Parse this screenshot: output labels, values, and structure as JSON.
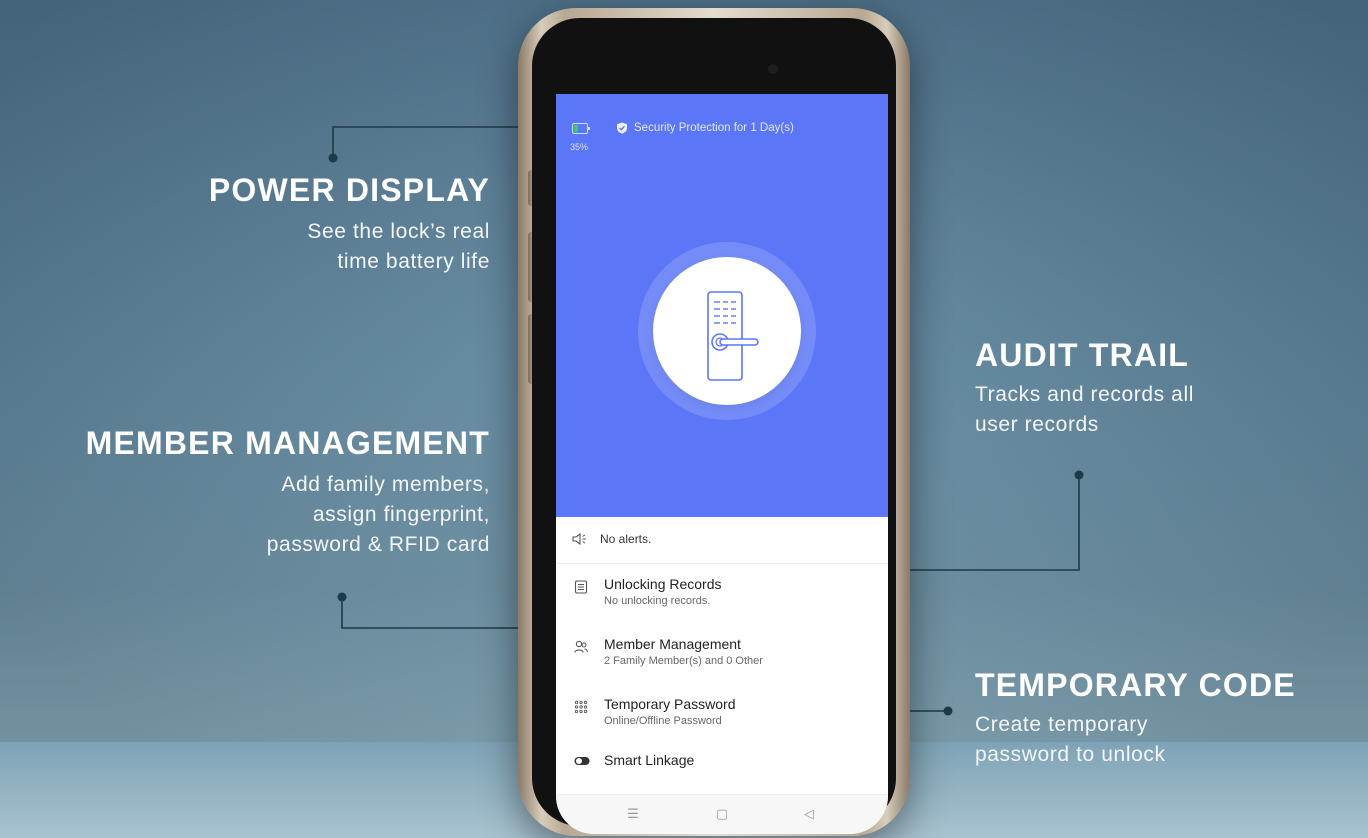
{
  "features": {
    "power": {
      "title": "POWER DISPLAY",
      "desc1": "See the lock’s real",
      "desc2": "time battery life"
    },
    "member": {
      "title": "MEMBER MANAGEMENT",
      "desc1": "Add family members,",
      "desc2": "assign fingerprint,",
      "desc3": "password & RFID card"
    },
    "audit": {
      "title": "AUDIT TRAIL",
      "desc1": "Tracks and records all",
      "desc2": "user records"
    },
    "temp": {
      "title": "TEMPORARY CODE",
      "desc1": "Create temporary",
      "desc2": "password to unlock"
    }
  },
  "app": {
    "battery_percent": "35%",
    "battery_level": 0.35,
    "security_text": "Security Protection for 1 Day(s)",
    "alerts_text": "No alerts.",
    "menu": [
      {
        "title": "Unlocking Records",
        "subtitle": "No unlocking records.",
        "icon": "document-icon"
      },
      {
        "title": "Member Management",
        "subtitle": "2 Family Member(s) and 0 Other",
        "icon": "members-icon"
      },
      {
        "title": "Temporary Password",
        "subtitle": "Online/Offline Password",
        "icon": "keypad-icon"
      },
      {
        "title": "Smart Linkage",
        "subtitle": "",
        "icon": "toggle-icon"
      }
    ],
    "nav": [
      "menu-icon",
      "home-square-icon",
      "back-triangle-icon"
    ]
  },
  "colors": {
    "hero": "#5b76f7",
    "callout_line": "#1c3a47",
    "battery_fill": "#2fd27a"
  }
}
